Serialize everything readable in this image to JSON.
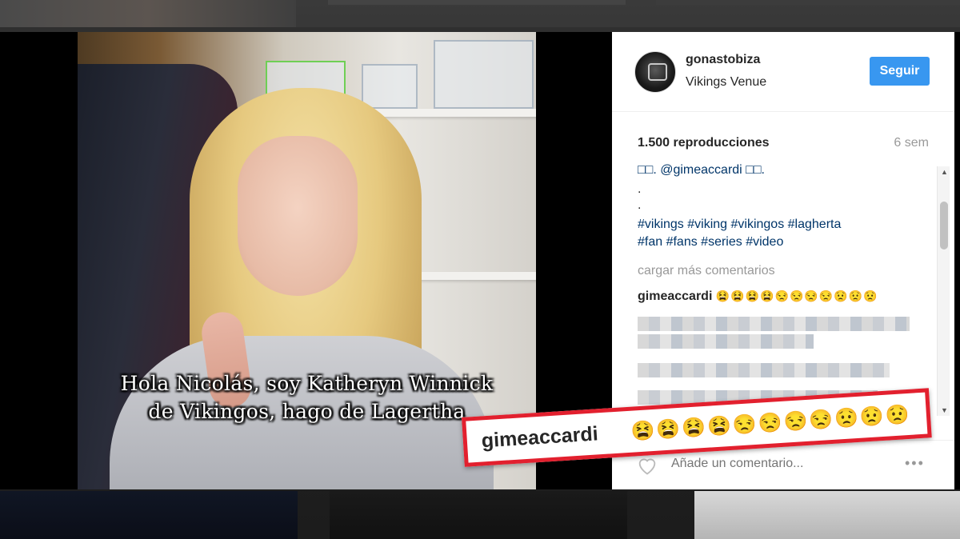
{
  "post": {
    "username": "gonastobiza",
    "location": "Vikings Venue",
    "follow_label": "Seguir",
    "views": "1.500 reproducciones",
    "age": "6 sem"
  },
  "video": {
    "subtitle_line1": "Hola Nicolás, soy Katheryn Winnick",
    "subtitle_line2": "de Vikingos, hago de Lagertha"
  },
  "caption": {
    "mention_line": "□□. @gimeaccardi □□.",
    "dot1": ".",
    "dot2": ".",
    "hashtags_line1": "#vikings #viking #vikingos #lagherta",
    "hashtags_line2": "#fan #fans #series #video"
  },
  "comments": {
    "load_more": "cargar más comentarios",
    "first_user": "gimeaccardi",
    "first_emojis": "😫😫😫😫😒😒😒😒😟😟😟"
  },
  "add_comment": {
    "placeholder": "Añade un comentario...",
    "more": "•••"
  },
  "callout": {
    "user": "gimeaccardi",
    "emojis": "😫😫😫😫😒😒😒😒😟😟😟"
  },
  "colors": {
    "follow": "#3897f0",
    "highlight": "#e2202e",
    "link": "#003569"
  }
}
